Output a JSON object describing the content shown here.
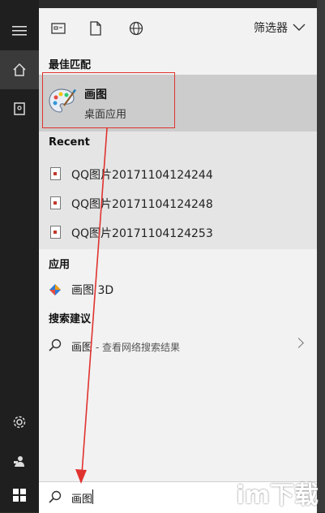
{
  "topbar": {
    "filter_label": "筛选器"
  },
  "best_match": {
    "title": "最佳匹配",
    "name": "画图",
    "subtitle": "桌面应用"
  },
  "recent": {
    "title": "Recent",
    "items": [
      {
        "label": "QQ图片20171104124244"
      },
      {
        "label": "QQ图片20171104124248"
      },
      {
        "label": "QQ图片20171104124253"
      }
    ]
  },
  "apps": {
    "title": "应用",
    "items": [
      {
        "label": "画图 3D"
      }
    ]
  },
  "suggestions": {
    "title": "搜索建议",
    "items": [
      {
        "main": "画图",
        "sub": " - 查看网络搜索结果"
      }
    ]
  },
  "search": {
    "value": "画图"
  },
  "watermark": {
    "text": "im下载"
  },
  "colors": {
    "rail": "#1f1f1f",
    "panel": "#f2f2f2",
    "best_bg": "#cccccc",
    "recent_bg": "#e5e5e5",
    "annotation": "#e0332f"
  }
}
